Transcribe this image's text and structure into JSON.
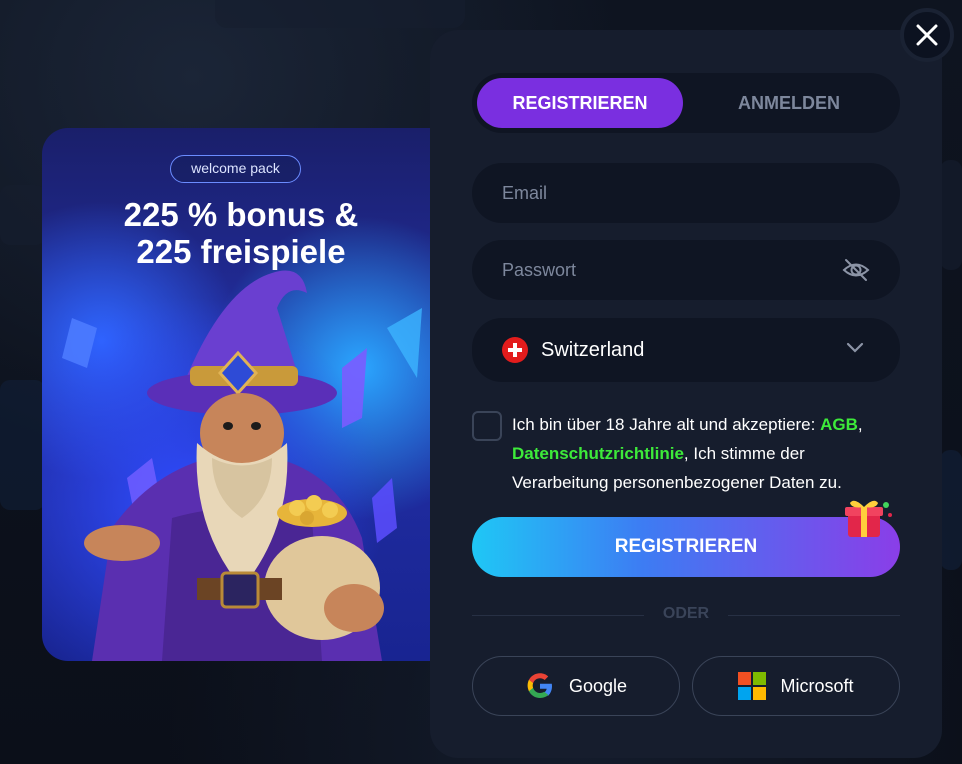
{
  "promo": {
    "badge": "welcome pack",
    "title_line1": "225 % bonus &",
    "title_line2": "225 freispiele"
  },
  "tabs": [
    {
      "label": "REGISTRIEREN",
      "active": true
    },
    {
      "label": "ANMELDEN",
      "active": false
    }
  ],
  "form": {
    "email_placeholder": "Email",
    "password_placeholder": "Passwort",
    "country": "Switzerland",
    "terms_prefix": "Ich bin über 18 Jahre alt und akzeptiere: ",
    "terms_agb": "AGB",
    "terms_comma": ",",
    "terms_privacy": "Datenschutzrichtlinie",
    "terms_suffix": ", Ich stimme der Verarbeitung personenbezogener Daten zu.",
    "submit_label": "REGISTRIEREN",
    "divider_label": "ODER"
  },
  "social": {
    "google_label": "Google",
    "microsoft_label": "Microsoft"
  },
  "colors": {
    "accent_purple": "#7a2fe0",
    "link_green": "#3dea3a",
    "panel_bg": "#161d2d",
    "field_bg": "#0f1523"
  },
  "icons": [
    "close-icon",
    "eye-off-icon",
    "swiss-flag-icon",
    "chevron-down-icon",
    "gift-icon",
    "google-icon",
    "microsoft-icon"
  ]
}
